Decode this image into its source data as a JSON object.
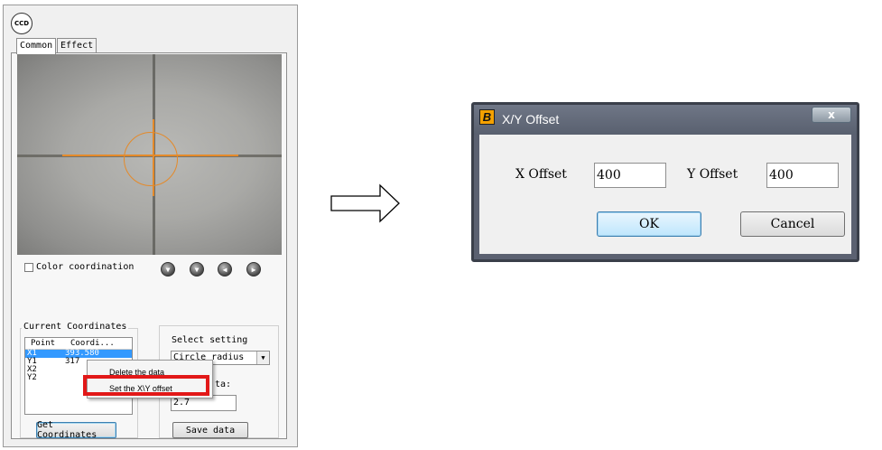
{
  "ccd_window": {
    "logo_text": "CCD",
    "tabs": [
      {
        "label": "Common"
      },
      {
        "label": "Effect"
      }
    ],
    "color_coordination_label": "Color coordination",
    "move_buttons": [
      "arrow-down-icon",
      "arrow-down-icon",
      "arrow-left-icon",
      "arrow-right-icon"
    ],
    "current_coordinates": {
      "title": "Current Coordinates",
      "columns": [
        "Point",
        "Coordi..."
      ],
      "rows": [
        {
          "point": "X1",
          "value": "393.580"
        },
        {
          "point": "Y1",
          "value": "317"
        },
        {
          "point": "X2",
          "value": ""
        },
        {
          "point": "Y2",
          "value": ""
        }
      ]
    },
    "select_setting": {
      "title": "Select setting",
      "selected": "Circle radius",
      "data_label_suffix": "ta:",
      "data_value": "2.7"
    },
    "get_coordinates_label": "Get Coordinates",
    "save_data_label": "Save data",
    "context_menu": {
      "items": [
        {
          "label": "Delete the data"
        },
        {
          "label": "Set the X\\Y offset"
        }
      ]
    }
  },
  "dialog": {
    "title": "X/Y Offset",
    "logo_letter": "B",
    "close_label": "x",
    "x_offset_label": "X Offset",
    "x_offset_value": "400",
    "y_offset_label": "Y Offset",
    "y_offset_value": "400",
    "ok_label": "OK",
    "cancel_label": "Cancel"
  },
  "colors": {
    "highlight": "#e21818",
    "selection": "#3399ff",
    "title_bar": "#5b6171",
    "crosshair": "#e48a2a"
  }
}
